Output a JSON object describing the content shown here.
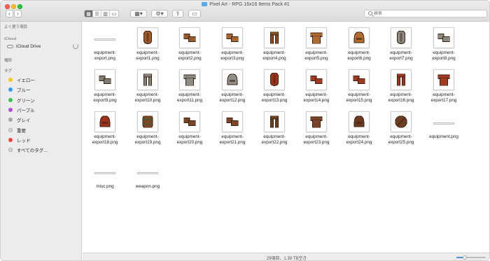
{
  "window": {
    "title": "Pixel Art - RPG 16x16 Items Pack #1"
  },
  "toolbar": {
    "back": "‹",
    "forward": "›",
    "view_modes": [
      "▦",
      "☰",
      "▥",
      "▭"
    ],
    "group_by_icon": "▦▾",
    "action_icon": "⚙▾",
    "share_icon": "⇪",
    "tag_icon": "▭"
  },
  "search": {
    "placeholder": "検索"
  },
  "sidebar": {
    "favorites_header": "よく使う項目",
    "icloud_header": "iCloud",
    "icloud_drive": "iCloud Drive",
    "places_header": "場所",
    "tags_header": "タグ",
    "tags": [
      {
        "label": "イエロー",
        "color": "#f5c518"
      },
      {
        "label": "ブルー",
        "color": "#2f9bff"
      },
      {
        "label": "グリーン",
        "color": "#39c14a"
      },
      {
        "label": "パープル",
        "color": "#b24fd8"
      },
      {
        "label": "グレイ",
        "color": "#a5a5a5"
      },
      {
        "label": "重要",
        "color": "#d9d9d9"
      },
      {
        "label": "レッド",
        "color": "#f0453a"
      },
      {
        "label": "すべてのタグ...",
        "color": "#d9d9d9"
      }
    ]
  },
  "files": [
    {
      "line1": "equipment-",
      "line2": "export.png",
      "kind": "line",
      "color": "#ffffff"
    },
    {
      "line1": "equipment-",
      "line2": "export1.png",
      "kind": "shield",
      "color": "#a15a2c"
    },
    {
      "line1": "equipment-",
      "line2": "export2.png",
      "kind": "gloves",
      "color": "#9b5a2a"
    },
    {
      "line1": "equipment-",
      "line2": "export3.png",
      "kind": "gloves",
      "color": "#a8652e"
    },
    {
      "line1": "equipment-",
      "line2": "export4.png",
      "kind": "pants",
      "color": "#8a4e24"
    },
    {
      "line1": "equipment-",
      "line2": "export5.png",
      "kind": "armor",
      "color": "#b06a2e"
    },
    {
      "line1": "equipment-",
      "line2": "export6.png",
      "kind": "helmet",
      "color": "#b36c2c"
    },
    {
      "line1": "equipment-",
      "line2": "export7.png",
      "kind": "shield",
      "color": "#8c8c84"
    },
    {
      "line1": "equipment-",
      "line2": "export8.png",
      "kind": "gloves",
      "color": "#8b8a83"
    },
    {
      "line1": "equipment-",
      "line2": "export9.png",
      "kind": "gloves",
      "color": "#7f7e76"
    },
    {
      "line1": "equipment-",
      "line2": "export10.png",
      "kind": "pants",
      "color": "#85847c"
    },
    {
      "line1": "equipment-",
      "line2": "export11.png",
      "kind": "armor",
      "color": "#8d8c84"
    },
    {
      "line1": "equipment-",
      "line2": "export12.png",
      "kind": "helmet",
      "color": "#909088"
    },
    {
      "line1": "equipment-",
      "line2": "export13.png",
      "kind": "shield",
      "color": "#a0341c"
    },
    {
      "line1": "equipment-",
      "line2": "export14.png",
      "kind": "gloves",
      "color": "#a33a20"
    },
    {
      "line1": "equipment-",
      "line2": "export15.png",
      "kind": "gloves",
      "color": "#9e3a1f"
    },
    {
      "line1": "equipment-",
      "line2": "export16.png",
      "kind": "pants",
      "color": "#9c3520"
    },
    {
      "line1": "equipment-",
      "line2": "export17.png",
      "kind": "armor",
      "color": "#a23a20"
    },
    {
      "line1": "equipment-",
      "line2": "export18.png",
      "kind": "helmet",
      "color": "#a0321c"
    },
    {
      "line1": "equipment-",
      "line2": "export19.png",
      "kind": "barrel",
      "color": "#7a4a28"
    },
    {
      "line1": "equipment-",
      "line2": "export20.png",
      "kind": "gloves",
      "color": "#7a4525"
    },
    {
      "line1": "equipment-",
      "line2": "export21.png",
      "kind": "gloves",
      "color": "#7b4526"
    },
    {
      "line1": "equipment-",
      "line2": "export22.png",
      "kind": "pants",
      "color": "#6f3d21"
    },
    {
      "line1": "equipment-",
      "line2": "export23.png",
      "kind": "armor",
      "color": "#7a4526"
    },
    {
      "line1": "equipment-",
      "line2": "export24.png",
      "kind": "helmet",
      "color": "#6e3b20"
    },
    {
      "line1": "equipment-",
      "line2": "export25.png",
      "kind": "round",
      "color": "#6e3d22"
    },
    {
      "line1": "equipment.png",
      "line2": "",
      "kind": "line",
      "color": "#ffffff"
    },
    {
      "line1": "misc.png",
      "line2": "",
      "kind": "line",
      "color": "#ffffff"
    },
    {
      "line1": "weapon.png",
      "line2": "",
      "kind": "line",
      "color": "#ffffff"
    }
  ],
  "status": {
    "text": "29項目、1.39 TB空き",
    "icon_size_fraction": 0.28
  }
}
